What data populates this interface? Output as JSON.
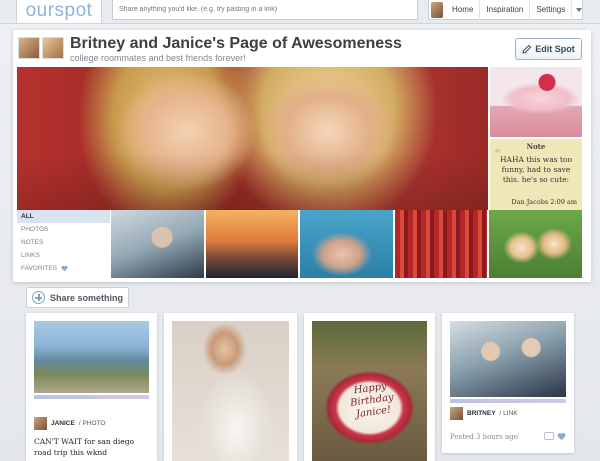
{
  "topbar": {
    "logo": "ourspot",
    "share_placeholder": "Share anything you'd like. (e.g. try pasting in a link)",
    "nav": [
      "Home",
      "Inspiration",
      "Settings"
    ]
  },
  "spot": {
    "title": "Britney and Janice's Page of Awesomeness",
    "subtitle": "college roommates and best friends forever!",
    "edit_label": "Edit Spot"
  },
  "note": {
    "title": "Note",
    "body": "HAHA this was too funny, had to save this. he's so cute:",
    "signature": "Dan Jacobs 2:09 am"
  },
  "filters": [
    "ALL",
    "PHOTOS",
    "NOTES",
    "LINKS",
    "FAVORITES"
  ],
  "share_button": "Share something",
  "posts": [
    {
      "author": "JANICE",
      "type": "/ PHOTO",
      "text": "CAN'T WAIT for san diego road trip this wknd"
    },
    {},
    {
      "cake_text": "Happy Birthday Janice!"
    },
    {
      "author": "BRITNEY",
      "type": "/ LINK",
      "time": "Posted 3 hours ago"
    }
  ],
  "colors": {
    "accent": "#8fb3dd",
    "active_filter_bg": "#d8e3ef",
    "heart": "#8fa8cf"
  }
}
